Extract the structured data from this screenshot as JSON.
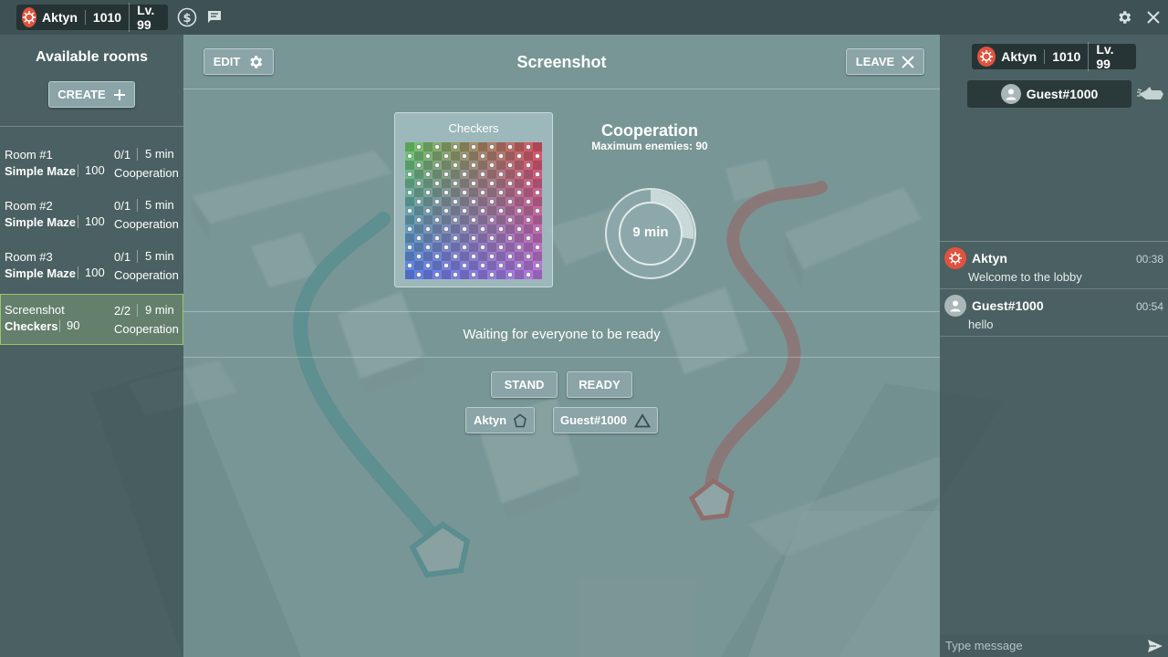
{
  "topbar": {
    "username": "Aktyn",
    "points": "1010",
    "level": "Lv. 99"
  },
  "rooms_panel": {
    "title": "Available rooms",
    "create_label": "CREATE",
    "rooms": [
      {
        "name": "Room #1",
        "map": "Simple Maze",
        "enemies": "100",
        "players": "0/1",
        "time": "5 min",
        "mode": "Cooperation"
      },
      {
        "name": "Room #2",
        "map": "Simple Maze",
        "enemies": "100",
        "players": "0/1",
        "time": "5 min",
        "mode": "Cooperation"
      },
      {
        "name": "Room #3",
        "map": "Simple Maze",
        "enemies": "100",
        "players": "0/1",
        "time": "5 min",
        "mode": "Cooperation"
      },
      {
        "name": "Screenshot",
        "map": "Checkers",
        "enemies": "90",
        "players": "2/2",
        "time": "9 min",
        "mode": "Cooperation"
      }
    ]
  },
  "room_view": {
    "edit_label": "EDIT",
    "title": "Screenshot",
    "leave_label": "LEAVE",
    "map_name": "Checkers",
    "mode": "Cooperation",
    "max_enemies": "Maximum enemies: 90",
    "timer": "9 min",
    "status": "Waiting for everyone to be ready",
    "stand_label": "STAND",
    "ready_label": "READY",
    "players": [
      {
        "name": "Aktyn",
        "icon": "pentagon-icon"
      },
      {
        "name": "Guest#1000",
        "icon": "triangle-icon"
      }
    ]
  },
  "right_panel": {
    "user": {
      "name": "Aktyn",
      "points": "1010",
      "level": "Lv. 99"
    },
    "guest": {
      "name": "Guest#1000"
    },
    "chat": [
      {
        "author": "Aktyn",
        "time": "00:38",
        "text": "Welcome to the lobby",
        "avatar": "red"
      },
      {
        "author": "Guest#1000",
        "time": "00:54",
        "text": "hello",
        "avatar": "gray"
      }
    ],
    "input_placeholder": "Type message"
  },
  "colors": {
    "accent_red": "#e0533e",
    "selected_room_border": "#9bc46a",
    "panel_dark": "#3c5052"
  }
}
